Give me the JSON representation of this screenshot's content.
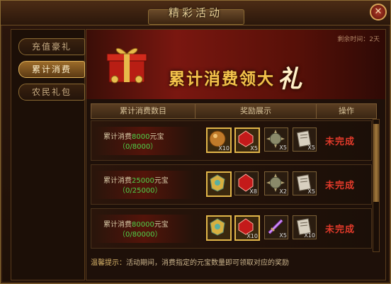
{
  "window": {
    "title": "精彩活动",
    "close_symbol": "✕"
  },
  "sidebar": {
    "tabs": [
      {
        "label": "充值豪礼"
      },
      {
        "label": "累计消费"
      },
      {
        "label": "农民礼包"
      }
    ],
    "active_index": 1
  },
  "banner": {
    "title_main": "累计消费领大",
    "title_big": "礼",
    "remaining_label": "剩余时间：2天"
  },
  "table": {
    "headers": [
      "累计消费数目",
      "奖励展示",
      "操作"
    ],
    "rows": [
      {
        "cond_prefix": "累计消费",
        "cond_amount": "8000",
        "cond_unit": "元宝",
        "progress": "（0/8000）",
        "items": [
          {
            "icon": "bronze-orb-icon",
            "count": "X10",
            "gold": true
          },
          {
            "icon": "red-gem-icon",
            "count": "X5",
            "gold": true
          },
          {
            "icon": "spiked-orb-icon",
            "count": "X5",
            "gold": false
          },
          {
            "icon": "scroll-icon",
            "count": "X5",
            "gold": false
          }
        ],
        "status": "未完成"
      },
      {
        "cond_prefix": "累计消费",
        "cond_amount": "25000",
        "cond_unit": "元宝",
        "progress": "（0/25000）",
        "items": [
          {
            "icon": "gold-amulet-icon",
            "count": "",
            "gold": true
          },
          {
            "icon": "red-gem-icon",
            "count": "X8",
            "gold": false
          },
          {
            "icon": "spiked-orb-icon",
            "count": "X2",
            "gold": false
          },
          {
            "icon": "scroll-icon",
            "count": "X5",
            "gold": false
          }
        ],
        "status": "未完成"
      },
      {
        "cond_prefix": "累计消费",
        "cond_amount": "80000",
        "cond_unit": "元宝",
        "progress": "（0/80000）",
        "items": [
          {
            "icon": "gold-amulet-icon",
            "count": "",
            "gold": true
          },
          {
            "icon": "red-gem-icon",
            "count": "X10",
            "gold": true
          },
          {
            "icon": "purple-sword-icon",
            "count": "X5",
            "gold": false
          },
          {
            "icon": "scroll-icon",
            "count": "X10",
            "gold": false
          }
        ],
        "status": "未完成"
      }
    ]
  },
  "footer": {
    "tip_label": "温馨提示：",
    "tip_text": "活动期间，消费指定的元宝数量即可领取对应的奖励"
  },
  "colors": {
    "accent_gold": "#e2b64a",
    "incomplete_red": "#e23a2a",
    "amount_green": "#4fd24a"
  }
}
